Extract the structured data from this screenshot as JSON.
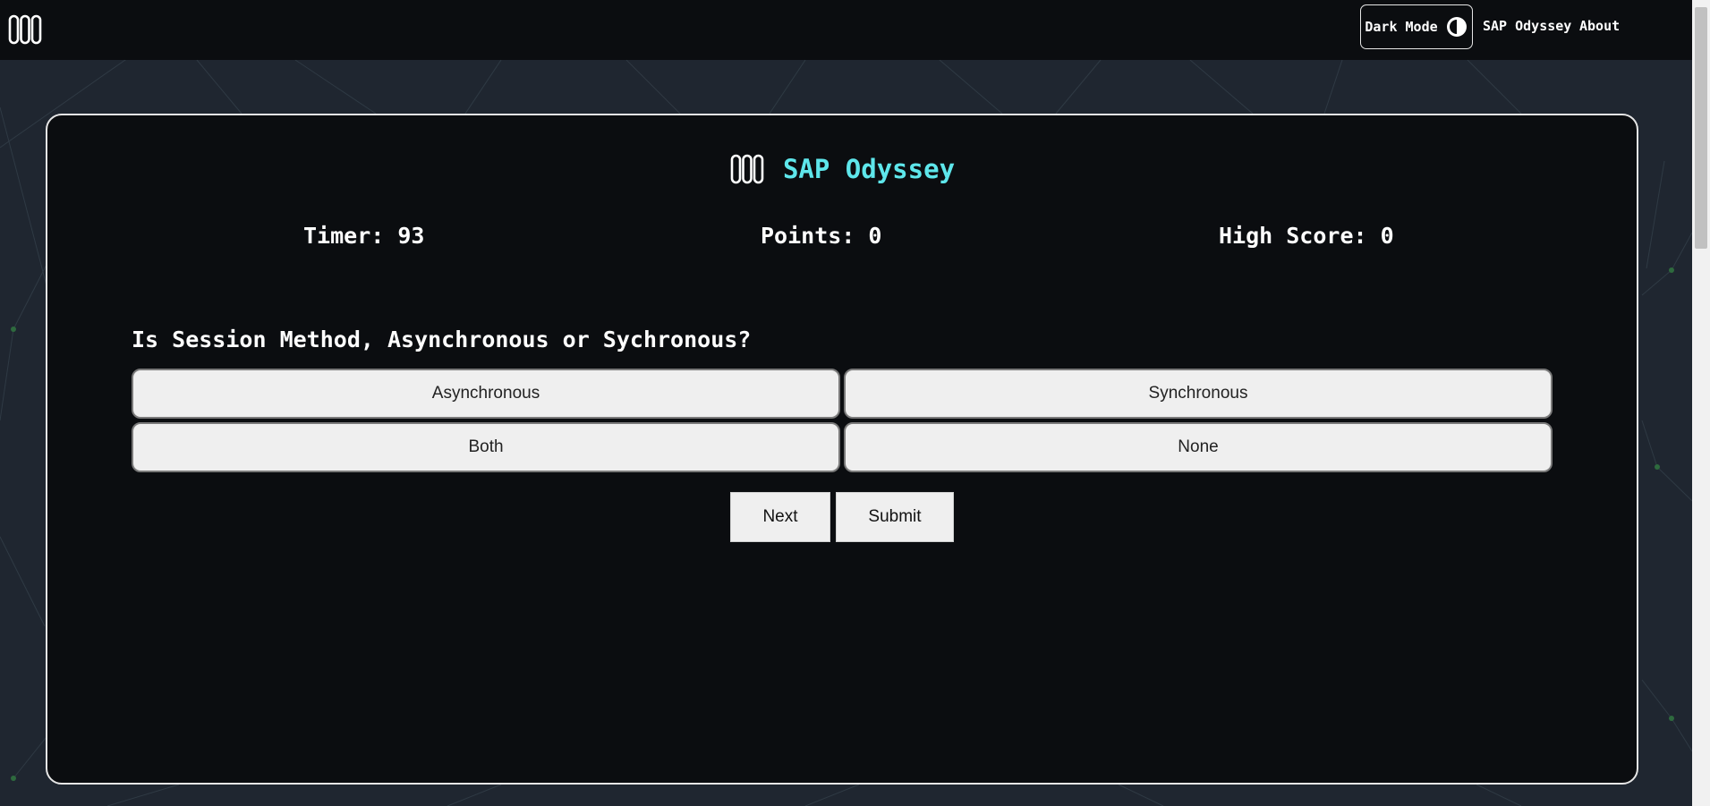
{
  "nav": {
    "dark_mode_label": "Dark Mode",
    "links": [
      "SAP Odyssey",
      "About"
    ]
  },
  "brand": {
    "title": "SAP Odyssey"
  },
  "stats": {
    "timer": "Timer: 93",
    "points": "Points: 0",
    "high_score": "High Score: 0"
  },
  "quiz": {
    "question": "Is Session Method, Asynchronous or Sychronous?",
    "answers": [
      "Asynchronous",
      "Synchronous",
      "Both",
      "None"
    ]
  },
  "actions": {
    "next": "Next",
    "submit": "Submit"
  },
  "colors": {
    "accent": "#5ee6eb",
    "background": "#0b0d10",
    "page": "#1f2630"
  },
  "icons": {
    "logo": "logo-icon",
    "theme": "half-circle-icon"
  }
}
